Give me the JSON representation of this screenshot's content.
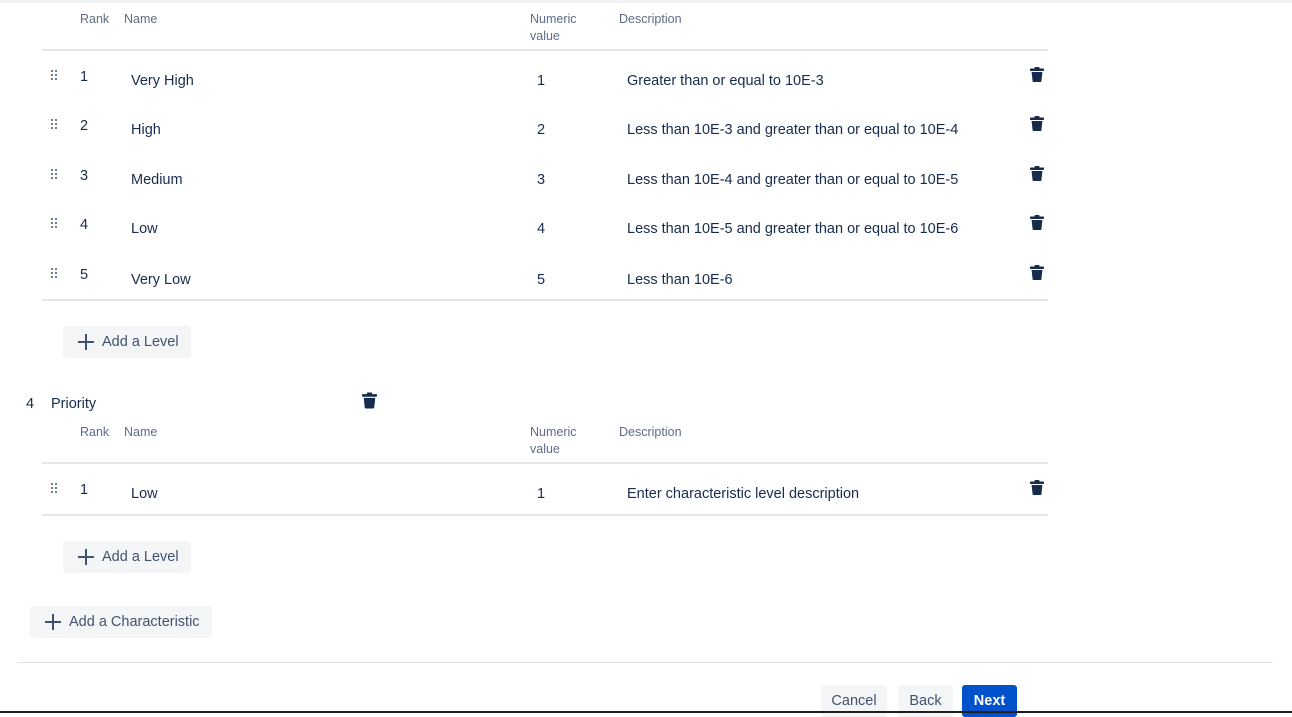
{
  "columns": {
    "rank": "Rank",
    "name": "Name",
    "numeric_line1": "Numeric",
    "numeric_line2": "value",
    "description": "Description"
  },
  "section1": {
    "rows": [
      {
        "rank": "1",
        "name": "Very High",
        "value": "1",
        "description": "Greater than or equal to 10E-3"
      },
      {
        "rank": "2",
        "name": "High",
        "value": "2",
        "description": "Less than 10E-3 and greater than or equal to 10E-4"
      },
      {
        "rank": "3",
        "name": "Medium",
        "value": "3",
        "description": "Less than 10E-4 and greater than or equal to 10E-5"
      },
      {
        "rank": "4",
        "name": "Low",
        "value": "4",
        "description": "Less than 10E-5 and greater than or equal to 10E-6"
      },
      {
        "rank": "5",
        "name": "Very Low",
        "value": "5",
        "description": "Less than 10E-6"
      }
    ],
    "add_level_label": "Add a Level"
  },
  "section2": {
    "number": "4",
    "name": "Priority",
    "rows": [
      {
        "rank": "1",
        "name": "Low",
        "value": "1",
        "description": "Enter characteristic level description"
      }
    ],
    "add_level_label": "Add a Level"
  },
  "add_characteristic_label": "Add a Characteristic",
  "footer": {
    "cancel": "Cancel",
    "back": "Back",
    "next": "Next"
  },
  "colors": {
    "primary": "#0052cc",
    "text": "#172b4d",
    "subtle_bg": "#f4f5f7",
    "icon": "#172b4d"
  },
  "icons": {
    "drag": "drag-handle-icon",
    "delete": "trash-icon",
    "add": "plus-icon"
  }
}
